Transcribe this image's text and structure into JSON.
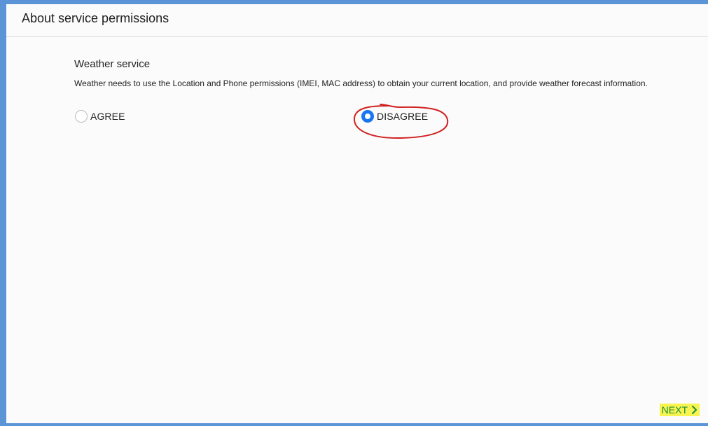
{
  "header": {
    "title": "About service permissions"
  },
  "service": {
    "title": "Weather service",
    "description": "Weather needs to use the Location and Phone permissions (IMEI, MAC address) to obtain your current location, and provide weather forecast information."
  },
  "options": {
    "agree": {
      "label": "AGREE",
      "selected": false
    },
    "disagree": {
      "label": "DISAGREE",
      "selected": true
    }
  },
  "footer": {
    "next_label": "NEXT",
    "next_icon": "chevron-right-icon"
  },
  "colors": {
    "accent": "#1976f0",
    "frame": "#5b95d8",
    "highlight": "#f7f34f",
    "annotation": "#d11f1f",
    "next_text": "#1b8f3f"
  }
}
